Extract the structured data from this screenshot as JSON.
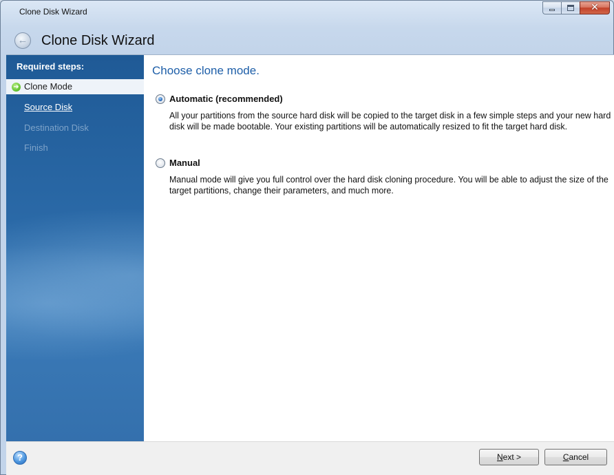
{
  "window": {
    "title": "Clone Disk Wizard",
    "caption_buttons": {
      "minimize_icon": "minimize-icon",
      "maximize_icon": "maximize-icon",
      "close_icon": "close-icon",
      "close_glyph": "✕"
    }
  },
  "header": {
    "title": "Clone Disk Wizard",
    "back_icon": "back-arrow-icon",
    "back_glyph": "←"
  },
  "sidebar": {
    "heading": "Required steps:",
    "steps": [
      {
        "label": "Clone Mode",
        "state": "active",
        "icon": "green-arrow-icon"
      },
      {
        "label": "Source Disk",
        "state": "link"
      },
      {
        "label": "Destination Disk",
        "state": "disabled"
      },
      {
        "label": "Finish",
        "state": "disabled"
      }
    ],
    "step_arrow_glyph": "➜"
  },
  "main": {
    "title": "Choose clone mode.",
    "options": [
      {
        "label": "Automatic (recommended)",
        "checked": true,
        "description": "All your partitions from the source hard disk will be copied to the target disk in a few simple steps and your new hard disk will be made bootable. Your existing partitions will be automatically resized to fit the target hard disk."
      },
      {
        "label": "Manual",
        "checked": false,
        "description": "Manual mode will give you full control over the hard disk cloning procedure. You will be able to adjust the size of the target partitions, change their parameters, and much more."
      }
    ]
  },
  "footer": {
    "help_icon": "help-icon",
    "help_glyph": "?",
    "next_mnemonic": "N",
    "next_rest": "ext >",
    "cancel_mnemonic": "C",
    "cancel_rest": "ancel"
  },
  "colors": {
    "sidebar_bg": "#2b6aa8",
    "title_blue": "#1d5ea8",
    "active_step_bg": "#eef3f9",
    "disabled_step": "#7ea3c9"
  }
}
